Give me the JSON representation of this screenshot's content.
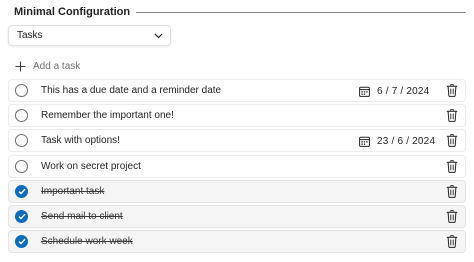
{
  "section": {
    "title": "Minimal Configuration"
  },
  "filter": {
    "selected": "Tasks"
  },
  "add_task": {
    "label": "Add a task"
  },
  "tasks": [
    {
      "text": "This has a due date and a reminder date",
      "completed": false,
      "due": "6 / 7 / 2024"
    },
    {
      "text": "Remember the important one!",
      "completed": false,
      "due": ""
    },
    {
      "text": "Task with options!",
      "completed": false,
      "due": "23 / 6 / 2024"
    },
    {
      "text": "Work on secret project",
      "completed": false,
      "due": ""
    },
    {
      "text": "Important task",
      "completed": true,
      "due": ""
    },
    {
      "text": "Send mail to client",
      "completed": true,
      "due": ""
    },
    {
      "text": "Schedule work week",
      "completed": true,
      "due": ""
    }
  ],
  "icons": {
    "dropdown": "chevron-down-icon",
    "add": "plus-icon",
    "due": "calendar-icon",
    "delete": "trash-icon",
    "completed": "checkmark-icon"
  },
  "colors": {
    "accent": "#0f6cbd",
    "text": "#242424",
    "muted": "#707070"
  }
}
